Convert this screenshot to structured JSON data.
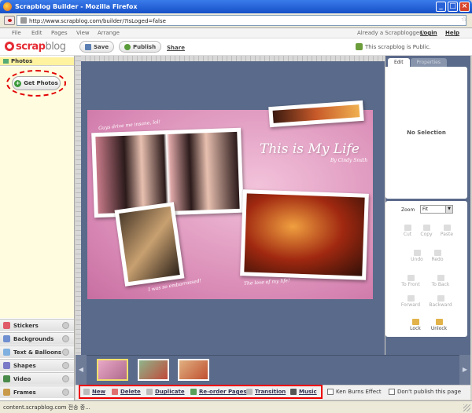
{
  "window": {
    "title": "Scrapblog Builder - Mozilla Firefox",
    "url": "http://www.scrapblog.com/builder/?IsLoged=false"
  },
  "menu": {
    "items": [
      "File",
      "Edit",
      "Pages",
      "View",
      "Arrange"
    ],
    "already": "Already a Scrapblogger?",
    "login": "Login",
    "help": "Help"
  },
  "toolbar": {
    "logo_scrap": "scrap",
    "logo_blog": "blog",
    "save": "Save",
    "publish": "Publish",
    "share": "Share",
    "public_status": "This scrapblog is Public."
  },
  "left": {
    "photos_header": "Photos",
    "get_photos": "Get Photos",
    "sections": [
      "Stickers",
      "Backgrounds",
      "Text & Balloons",
      "Shapes",
      "Video",
      "Frames"
    ]
  },
  "canvas": {
    "headline": "This is My Life",
    "byline": "By Cindy Smith",
    "caption_top": "Guys drive me insane, lol!",
    "caption_bottom": "I was so embarrassed!",
    "caption_right": "The love of my life!"
  },
  "right": {
    "tab_edit": "Edit",
    "tab_properties": "Properties",
    "no_selection": "No Selection",
    "zoom_label": "Zoom",
    "zoom_value": "Fit",
    "tools": [
      "Cut",
      "Copy",
      "Paste",
      "Undo",
      "Redo",
      "To Front",
      "To Back",
      "Forward",
      "Backward",
      "Lock",
      "Unlock"
    ]
  },
  "bottom": {
    "new": "New",
    "delete": "Delete",
    "duplicate": "Duplicate",
    "reorder": "Re-order Pages",
    "transition": "Transition",
    "music": "Music",
    "ken_burns": "Ken Burns Effect",
    "dont_publish": "Don't publish this page"
  },
  "status": {
    "text": "content.scrapblog.com 전송 중..."
  },
  "colors": {
    "title_blue": "#1750c8",
    "brand_red": "#e52b33",
    "stage": "#5a6a8a",
    "page_pink": "#d888b4",
    "highlight": "#fff3a0"
  }
}
